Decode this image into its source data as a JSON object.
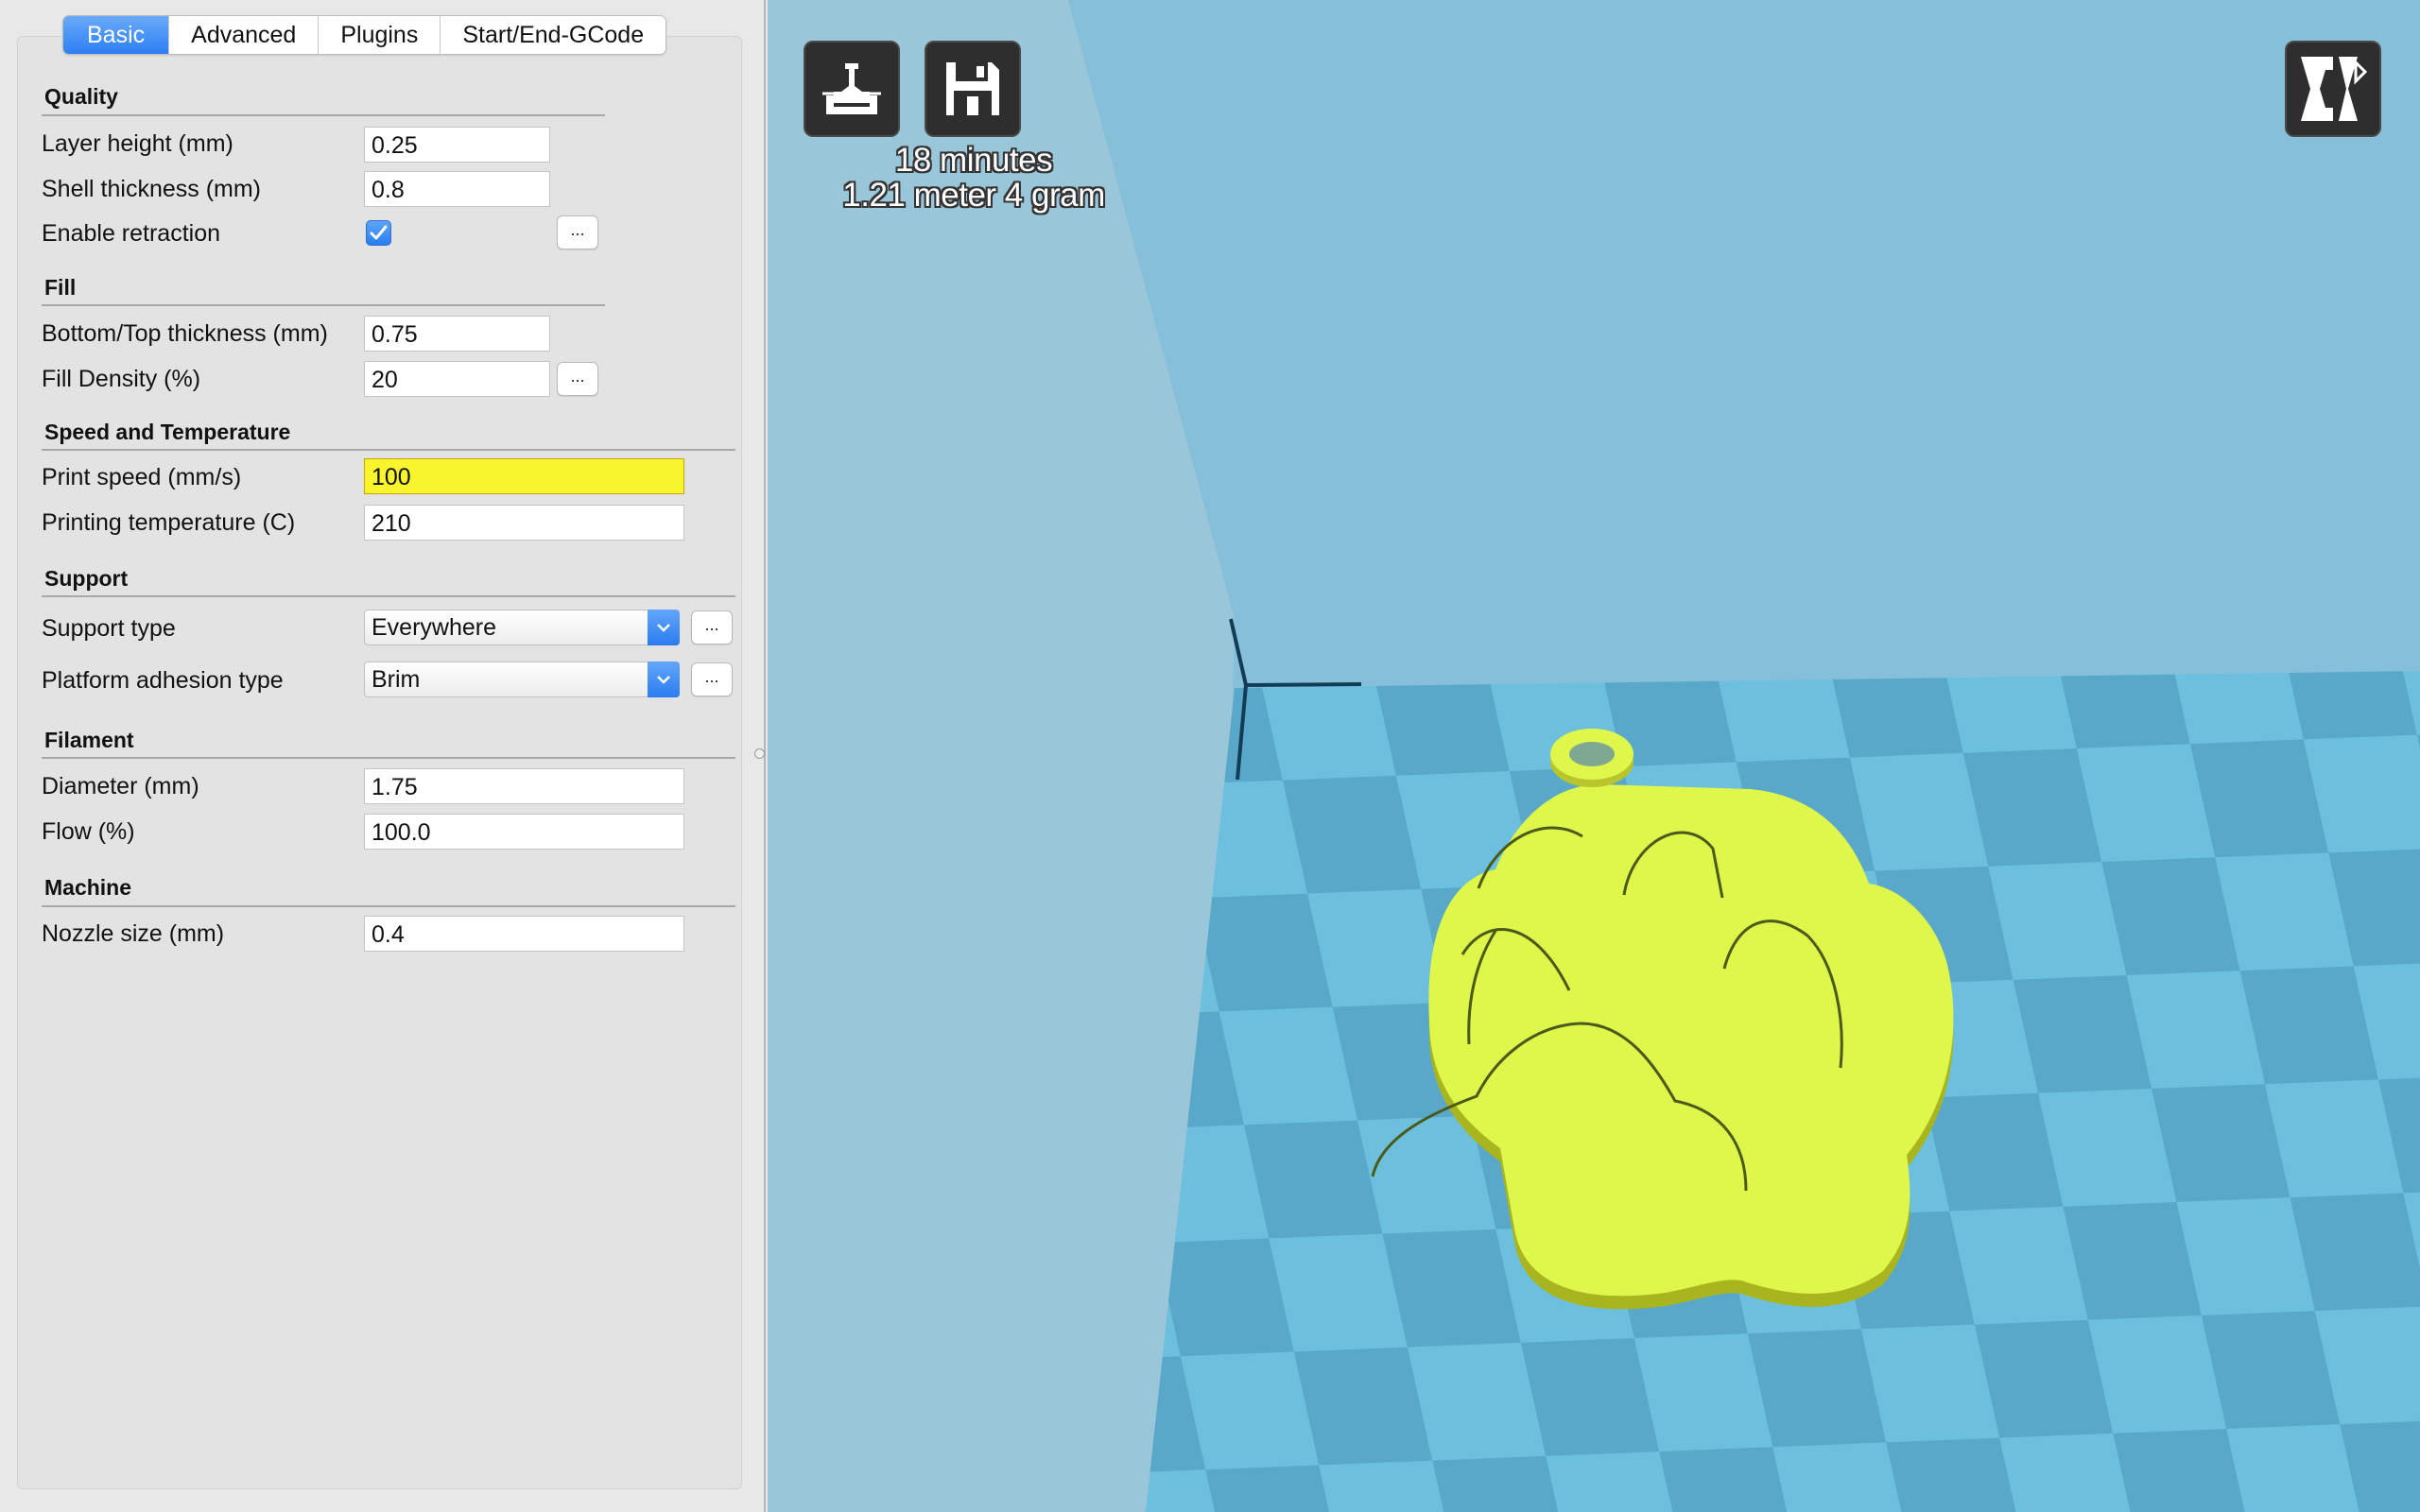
{
  "tabs": [
    {
      "label": "Basic",
      "active": true
    },
    {
      "label": "Advanced",
      "active": false
    },
    {
      "label": "Plugins",
      "active": false
    },
    {
      "label": "Start/End-GCode",
      "active": false
    }
  ],
  "quality": {
    "title": "Quality",
    "layer_height_label": "Layer height (mm)",
    "layer_height_value": "0.25",
    "shell_thickness_label": "Shell thickness (mm)",
    "shell_thickness_value": "0.8",
    "enable_retraction_label": "Enable retraction",
    "enable_retraction_checked": true,
    "more_label": "..."
  },
  "fill": {
    "title": "Fill",
    "bottom_top_label": "Bottom/Top thickness (mm)",
    "bottom_top_value": "0.75",
    "density_label": "Fill Density (%)",
    "density_value": "20",
    "more_label": "..."
  },
  "speed": {
    "title": "Speed and Temperature",
    "print_speed_label": "Print speed (mm/s)",
    "print_speed_value": "100",
    "temperature_label": "Printing temperature (C)",
    "temperature_value": "210"
  },
  "support": {
    "title": "Support",
    "support_type_label": "Support type",
    "support_type_value": "Everywhere",
    "adhesion_label": "Platform adhesion type",
    "adhesion_value": "Brim",
    "more_label": "..."
  },
  "filament": {
    "title": "Filament",
    "diameter_label": "Diameter (mm)",
    "diameter_value": "1.75",
    "flow_label": "Flow (%)",
    "flow_value": "100.0"
  },
  "machine": {
    "title": "Machine",
    "nozzle_label": "Nozzle size (mm)",
    "nozzle_value": "0.4"
  },
  "viewport": {
    "print_time": "18 minutes",
    "material": "1.21 meter 4 gram",
    "load_icon": "load-model-icon",
    "save_icon": "save-disk-icon",
    "view_mode_icon": "view-mode-icon"
  },
  "colors": {
    "highlight_field": "#f9f52c",
    "accent_blue": "#2c7ff4",
    "model_yellow": "#dff64a",
    "platform_light": "#6fc0dd",
    "platform_dark": "#5ba9c8",
    "background_blue": "#85bfda"
  }
}
